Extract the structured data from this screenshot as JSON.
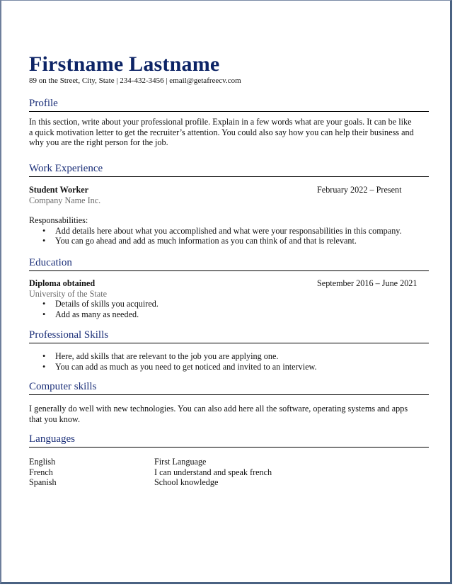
{
  "header": {
    "name": "Firstname Lastname",
    "contact": "89 on the Street,  City,  State | 234-432-3456 |  email@getafreecv.com"
  },
  "profile": {
    "title": "Profile",
    "lines": [
      "In this section, write about your professional profile. Explain in a few words what are your goals.  It can be like",
      "a quick motivation letter to get the recruiter’s attention. You could also say how you can help their business and",
      "why you are the right person for the job."
    ]
  },
  "work": {
    "title": "Work Experience",
    "role": "Student Worker",
    "dates": "February 2022 – Present",
    "company": "Company Name Inc.",
    "resp_label": "Responsabilities:",
    "bullets": [
      "Add details here about what you accomplished and what were your responsabilities in this company.",
      "You can go ahead and add as much information as you can think of and that is relevant."
    ]
  },
  "education": {
    "title": "Education",
    "degree": "Diploma obtained",
    "dates": "September 2016 – June 2021",
    "school": "University of the State",
    "bullets": [
      "Details of skills you acquired.",
      "Add as many as needed."
    ]
  },
  "pro_skills": {
    "title": "Professional Skills",
    "bullets": [
      "Here, add skills that are relevant to the job you are applying one.",
      "You can add as much as you need to get noticed and invited to an interview."
    ]
  },
  "computer_skills": {
    "title": "Computer skills",
    "lines": [
      "I generally do well with new technologies. You can also add here all the software, operating systems and apps",
      "that you know."
    ]
  },
  "languages": {
    "title": "Languages",
    "items": [
      {
        "name": "English",
        "level": "First Language"
      },
      {
        "name": "French",
        "level": "I can understand and speak french"
      },
      {
        "name": "Spanish",
        "level": "School knowledge"
      }
    ]
  }
}
